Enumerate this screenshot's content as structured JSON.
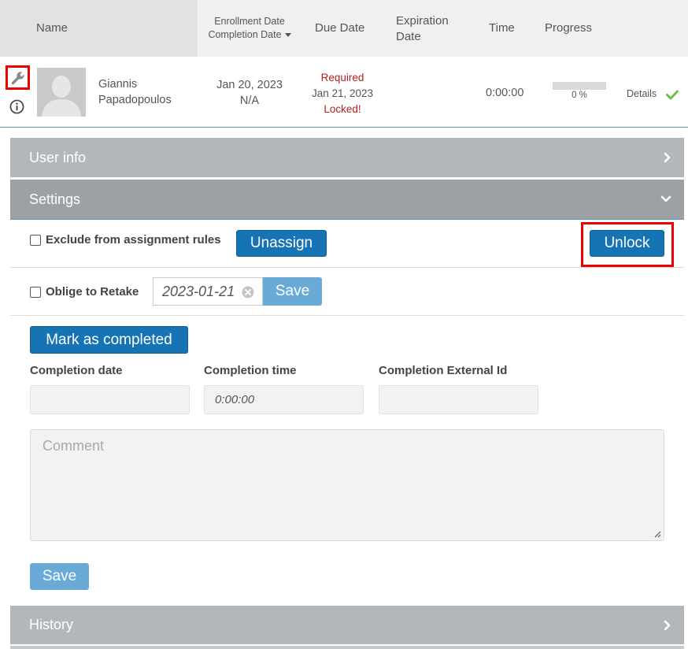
{
  "table": {
    "headers": {
      "name": "Name",
      "enrollment_date": "Enrollment Date",
      "completion_date": "Completion Date",
      "due_date": "Due Date",
      "expiration_date_line1": "Expiration",
      "expiration_date_line2": "Date",
      "time": "Time",
      "progress": "Progress"
    },
    "row": {
      "first_name": "Giannis",
      "last_name": "Papadopoulos",
      "enrollment_date": "Jan 20, 2023",
      "completion_date": "N/A",
      "due_status": "Required",
      "due_date": "Jan 21, 2023",
      "lock_status": "Locked!",
      "time": "0:00:00",
      "progress_label": "0 %",
      "progress_value": 0,
      "details_label": "Details"
    }
  },
  "panels": {
    "user_info": "User info",
    "settings": "Settings",
    "history": "History"
  },
  "settings": {
    "exclude_label": "Exclude from assignment rules",
    "unassign_label": "Unassign",
    "unlock_label": "Unlock",
    "oblige_label": "Oblige to Retake",
    "retake_date": "2023-01-21",
    "save_retake_label": "Save",
    "mark_completed_label": "Mark as completed",
    "completion_date_label": "Completion date",
    "completion_date_value": "",
    "completion_time_label": "Completion time",
    "completion_time_placeholder": "0:00:00",
    "completion_external_id_label": "Completion External Id",
    "completion_external_id_value": "",
    "comment_placeholder": "Comment",
    "save_label": "Save"
  },
  "colors": {
    "primary_button": "#1673b4",
    "light_button": "#6aaad6",
    "panel_header": "#b3b7bb",
    "highlight_box": "#ee0000",
    "locked_text": "#b22222",
    "check": "#6cc04a"
  },
  "icons": {
    "wrench": "wrench-icon",
    "info": "info-icon",
    "check": "check-icon",
    "chevron_right": "chevron-right-icon",
    "chevron_down": "chevron-down-icon",
    "clear": "clear-icon"
  }
}
